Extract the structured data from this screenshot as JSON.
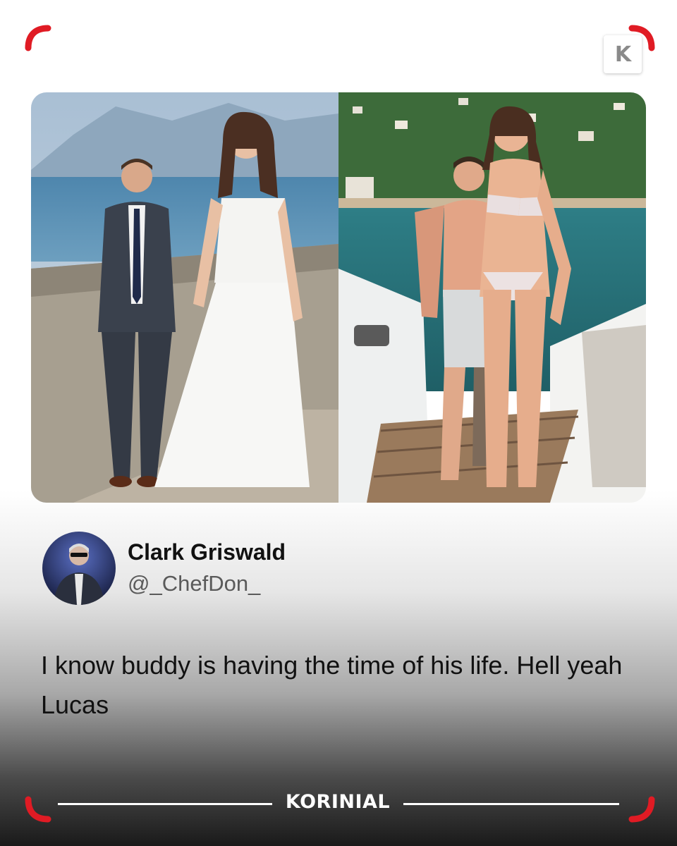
{
  "brand": {
    "badge_letter": "K",
    "footer_name": "KORINIAL",
    "accent_color": "#e01b24"
  },
  "post": {
    "display_name": "Clark Griswald",
    "handle": "@_ChefDon_",
    "text": "I know buddy is having the time of his life. Hell yeah Lucas"
  },
  "images": [
    {
      "name": "wedding-photo"
    },
    {
      "name": "yacht-photo"
    }
  ],
  "avatar": {
    "name": "profile-avatar"
  }
}
